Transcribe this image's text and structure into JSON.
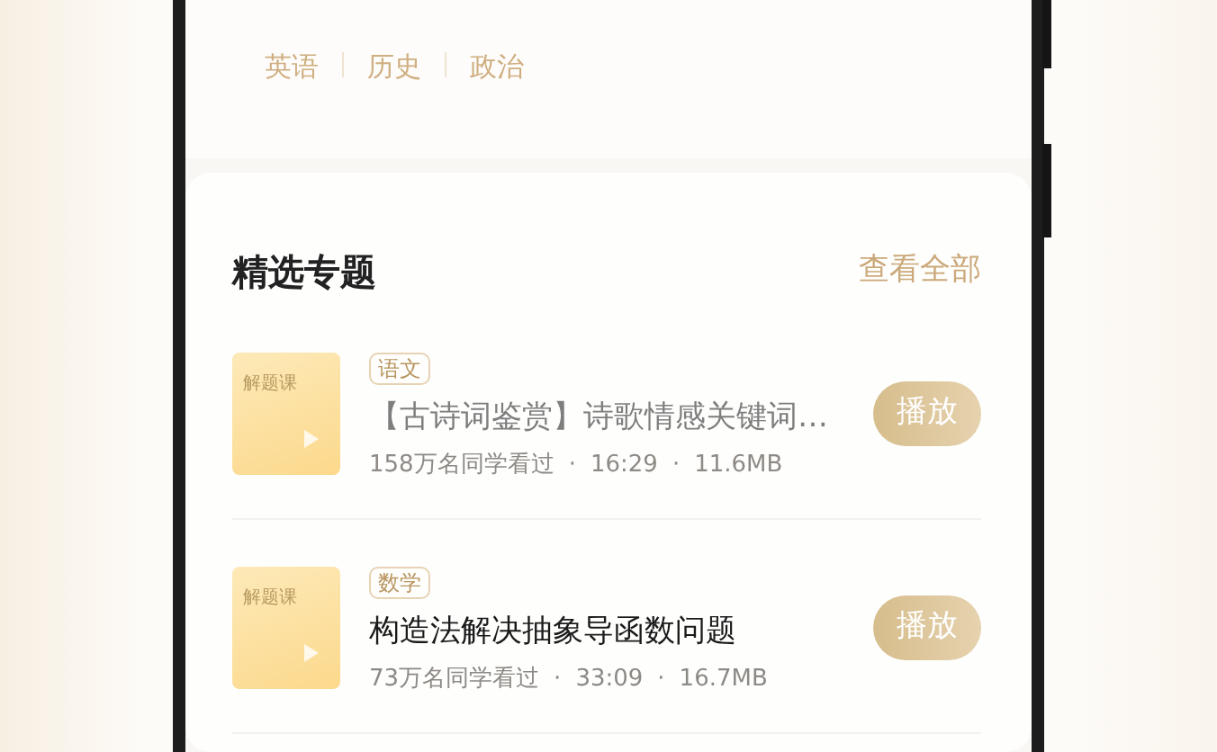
{
  "subjects": [
    {
      "label": "英语"
    },
    {
      "label": "历史"
    },
    {
      "label": "政治"
    }
  ],
  "section": {
    "title": "精选专题",
    "more": "查看全部"
  },
  "items": [
    {
      "thumb_label": "解题课",
      "tag": "语文",
      "title": "【古诗词鉴赏】诗歌情感关键词…",
      "watched": true,
      "views": "158万名同学看过",
      "sep1": "·",
      "duration": "16:29",
      "sep2": "·",
      "size": "11.6MB",
      "button": "播放"
    },
    {
      "thumb_label": "解题课",
      "tag": "数学",
      "title": "构造法解决抽象导函数问题",
      "watched": false,
      "views": "73万名同学看过",
      "sep1": "·",
      "duration": "33:09",
      "sep2": "·",
      "size": "16.7MB",
      "button": "播放"
    }
  ]
}
